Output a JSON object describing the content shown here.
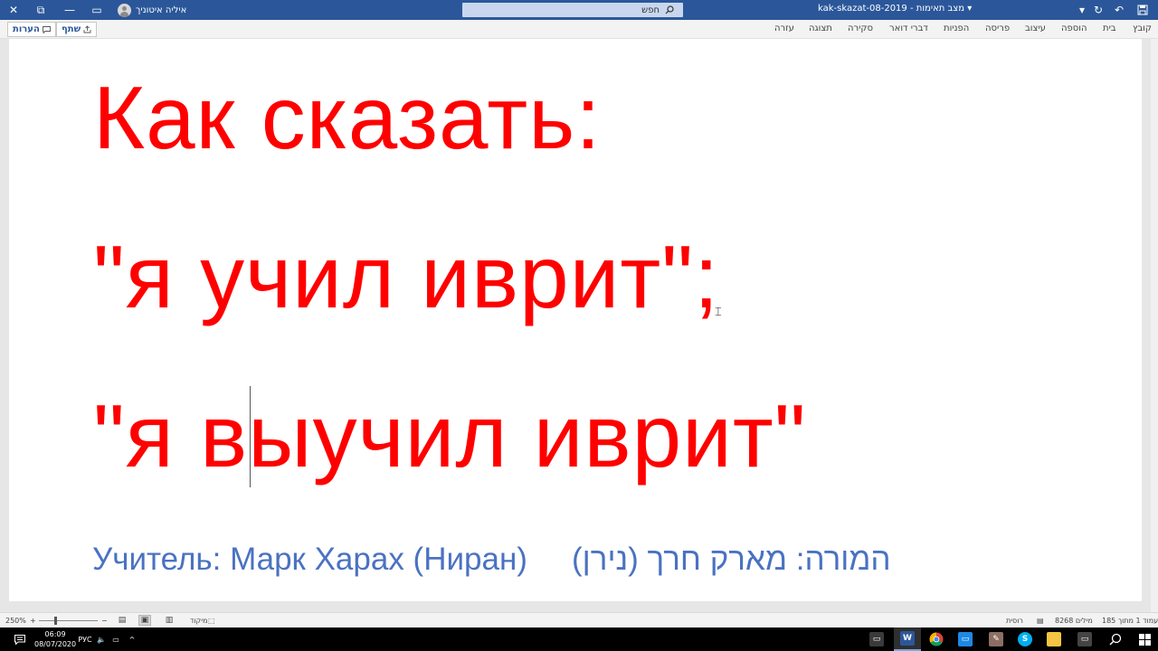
{
  "titlebar": {
    "user_name": "איליה איטוניך",
    "search_placeholder": "חפש",
    "doc_title": "kak-skazat-08-2019  -  מצב תאימות ▾",
    "close_glyph": "✕",
    "restore_glyph": "⧉",
    "minimize_glyph": "—",
    "ribbon_display_glyph": "▭",
    "save_glyph": "🖫",
    "undo_glyph": "↶",
    "redo_glyph": "↻",
    "customize_glyph": "▾"
  },
  "ribbon": {
    "tabs": [
      "קובץ",
      "בית",
      "הוספה",
      "עיצוב",
      "פריסה",
      "הפניות",
      "דברי דואר",
      "סקירה",
      "תצוגה",
      "עזרה"
    ],
    "share_label": "שתף",
    "comments_label": "הערות"
  },
  "document": {
    "line1": "Как сказать:",
    "line2": "\"я учил иврит\";",
    "line3": "\"я выучил иврит\"",
    "teacher_ru": "Учитель: Марк Харах (Ниран)",
    "teacher_he": "המורה: מארק חרך (נירן)"
  },
  "statusbar": {
    "zoom": "250%",
    "minus": "−",
    "plus": "+",
    "focus_label": "מיקוד",
    "language": "רוסית",
    "word_count": "8268 מילים",
    "page_info": "עמוד 1 מתוך 185"
  },
  "taskbar": {
    "time": "06:09",
    "date": "08/07/2020",
    "language": "РУС",
    "word_label": "W",
    "skype_label": "S"
  },
  "colors": {
    "title_bar": "#2b579a",
    "heading_red": "#ff0000",
    "teacher_blue": "#4a72c2"
  }
}
